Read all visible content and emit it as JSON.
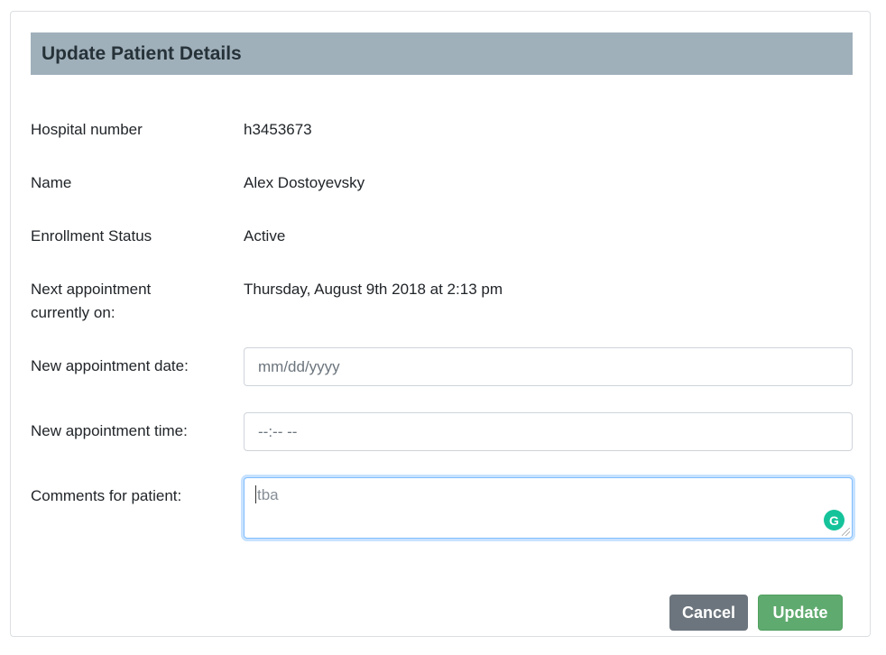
{
  "header": {
    "title": "Update Patient Details"
  },
  "details": [
    {
      "label": "Hospital number",
      "value": "h3453673"
    },
    {
      "label": "Name",
      "value": "Alex Dostoyevsky"
    },
    {
      "label": "Enrollment Status",
      "value": "Active"
    },
    {
      "label_line1": "Next appointment",
      "label_line2": "currently on:",
      "value": "Thursday, August 9th 2018 at 2:13 pm"
    }
  ],
  "form": {
    "date": {
      "label": "New appointment date:",
      "placeholder": "mm/dd/yyyy"
    },
    "time": {
      "label": "New appointment time:",
      "placeholder": "--:-- --"
    },
    "comments": {
      "label": "Comments for patient:",
      "placeholder": "tba"
    }
  },
  "buttons": {
    "cancel": "Cancel",
    "update": "Update"
  },
  "icons": {
    "grammarly": "grammarly-icon"
  },
  "colors": {
    "header_bg": "#a0b0bb",
    "cancel_bg": "#6c757d",
    "update_bg": "#5faa6e",
    "grammarly": "#15c39a",
    "focus_border": "#80bdff"
  }
}
